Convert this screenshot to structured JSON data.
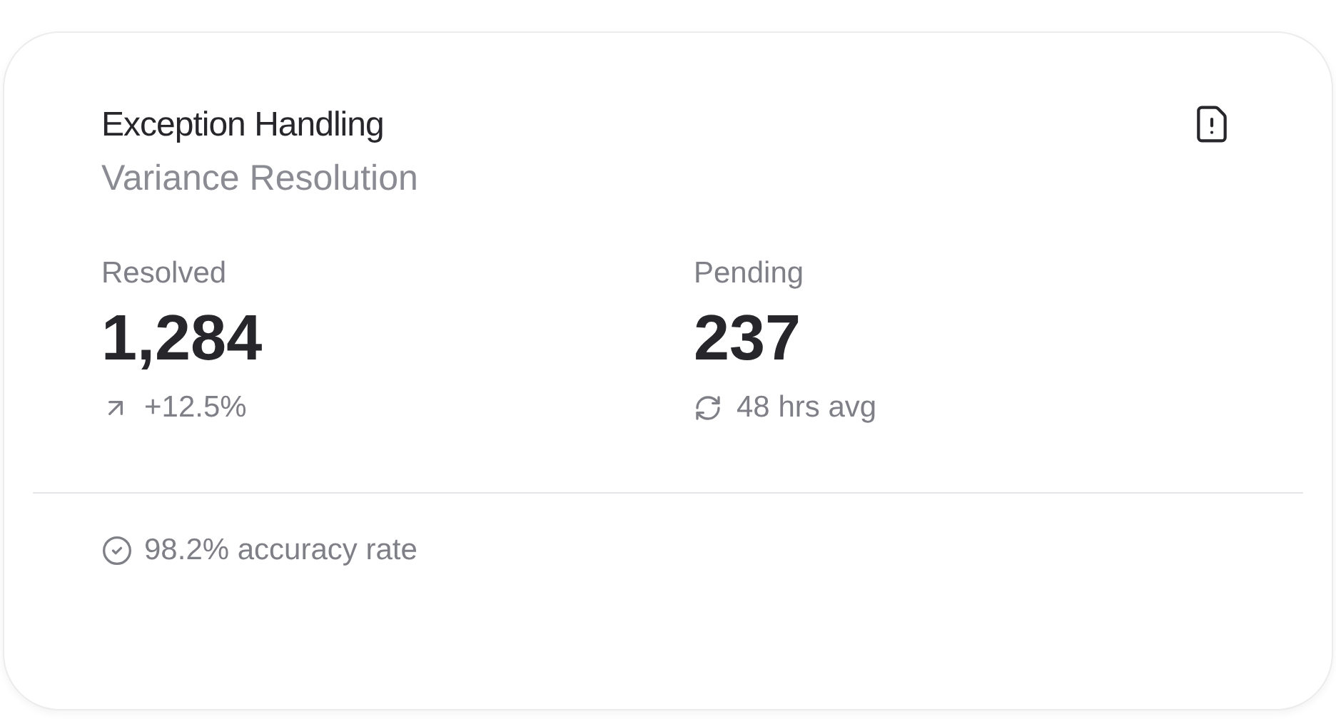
{
  "card": {
    "title": "Exception Handling",
    "subtitle": "Variance Resolution",
    "stats": [
      {
        "label": "Resolved",
        "value": "1,284",
        "note": "+12.5%",
        "kind": "trend"
      },
      {
        "label": "Pending",
        "value": "237",
        "note": "48 hrs avg",
        "kind": "cycle"
      }
    ],
    "footer": "98.2% accuracy rate"
  }
}
